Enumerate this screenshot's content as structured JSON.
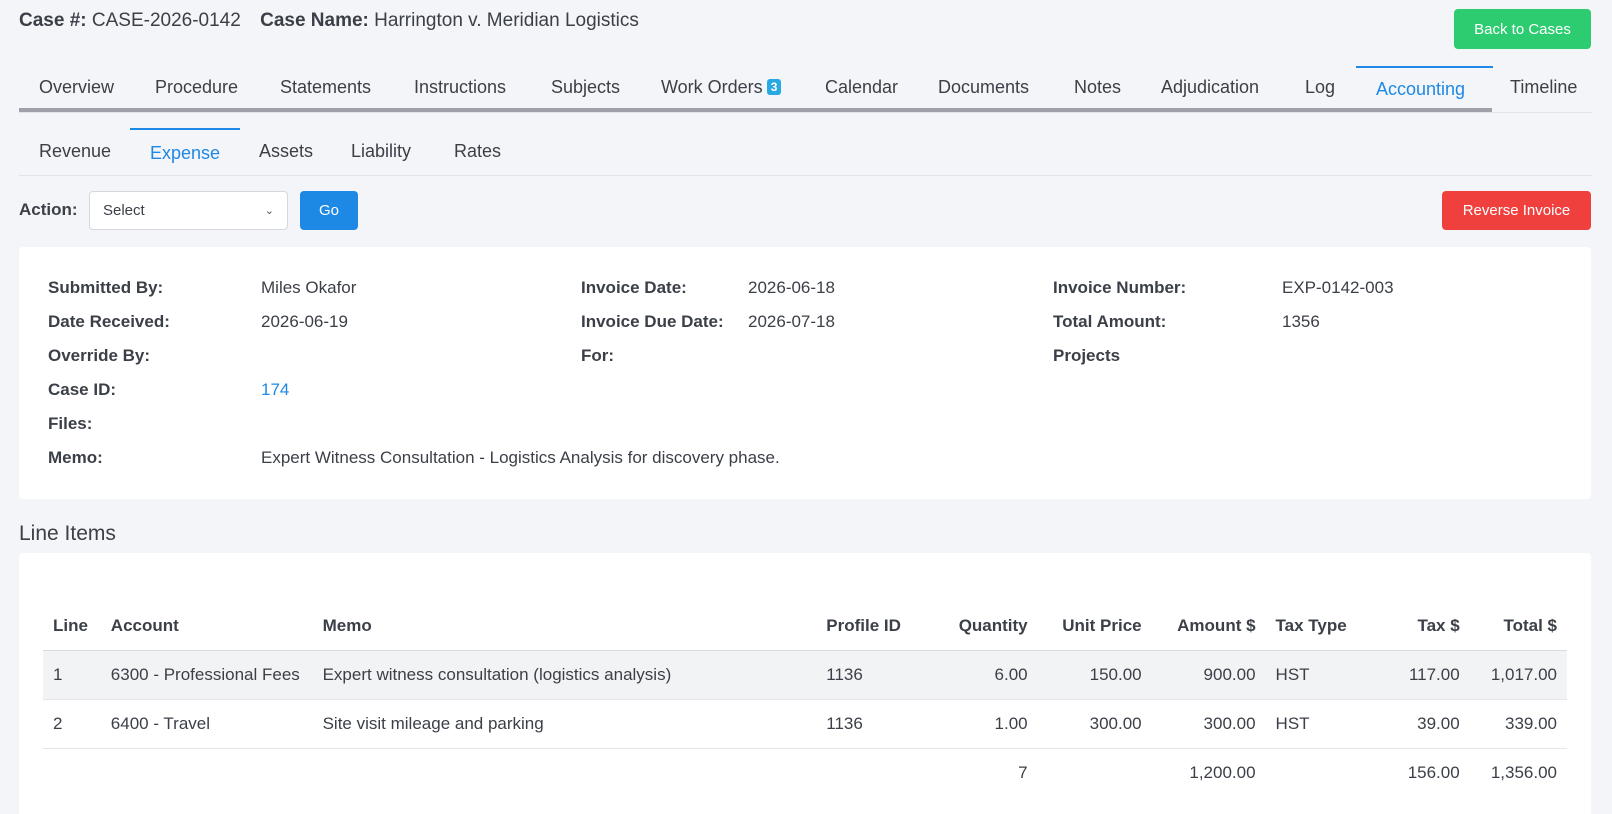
{
  "header": {
    "case_no_label": "Case #:",
    "case_no": "CASE-2026-0142",
    "case_name_label": "Case Name:",
    "case_name": "Harrington v. Meridian Logistics",
    "back_button": "Back to Cases"
  },
  "tabs": [
    {
      "label": "Overview"
    },
    {
      "label": "Procedure"
    },
    {
      "label": "Statements"
    },
    {
      "label": "Instructions"
    },
    {
      "label": "Subjects"
    },
    {
      "label": "Work Orders",
      "badge": "3"
    },
    {
      "label": "Calendar"
    },
    {
      "label": "Documents"
    },
    {
      "label": "Notes"
    },
    {
      "label": "Adjudication"
    },
    {
      "label": "Log"
    },
    {
      "label": "Accounting",
      "active": true
    },
    {
      "label": "Timeline"
    }
  ],
  "subtabs": [
    {
      "label": "Revenue"
    },
    {
      "label": "Expense",
      "active": true
    },
    {
      "label": "Assets"
    },
    {
      "label": "Liability"
    },
    {
      "label": "Rates"
    }
  ],
  "actions": {
    "label": "Action:",
    "select_value": "Select",
    "go_button": "Go",
    "reverse_button": "Reverse Invoice"
  },
  "details": {
    "submitted_by_label": "Submitted By:",
    "submitted_by": "Miles Okafor",
    "date_received_label": "Date Received:",
    "date_received": "2026-06-19",
    "override_by_label": "Override By:",
    "override_by": "",
    "case_id_label": "Case ID:",
    "case_id": "174",
    "files_label": "Files:",
    "files": "",
    "memo_label": "Memo:",
    "memo": "Expert Witness Consultation - Logistics Analysis for discovery phase.",
    "invoice_date_label": "Invoice Date:",
    "invoice_date": "2026-06-18",
    "invoice_due_label": "Invoice Due Date:",
    "invoice_due": "2026-07-18",
    "for_label": "For:",
    "for": "",
    "invoice_number_label": "Invoice Number:",
    "invoice_number": "EXP-0142-003",
    "total_amount_label": "Total Amount:",
    "total_amount": "1356",
    "projects_label": "Projects",
    "projects": ""
  },
  "line_items": {
    "title": "Line Items",
    "columns": [
      "Line",
      "Account",
      "Memo",
      "Profile ID",
      "Quantity",
      "Unit Price",
      "Amount $",
      "Tax Type",
      "Tax $",
      "Total $"
    ],
    "rows": [
      [
        "1",
        "6300 - Professional Fees",
        "Expert witness consultation (logistics analysis)",
        "1136",
        "6.00",
        "150.00",
        "900.00",
        "HST",
        "117.00",
        "1,017.00"
      ],
      [
        "2",
        "6400 - Travel",
        "Site visit mileage and parking",
        "1136",
        "1.00",
        "300.00",
        "300.00",
        "HST",
        "39.00",
        "339.00"
      ]
    ],
    "totals": [
      "",
      "",
      "",
      "",
      "7",
      "",
      "1,200.00",
      "",
      "156.00",
      "1,356.00"
    ]
  }
}
